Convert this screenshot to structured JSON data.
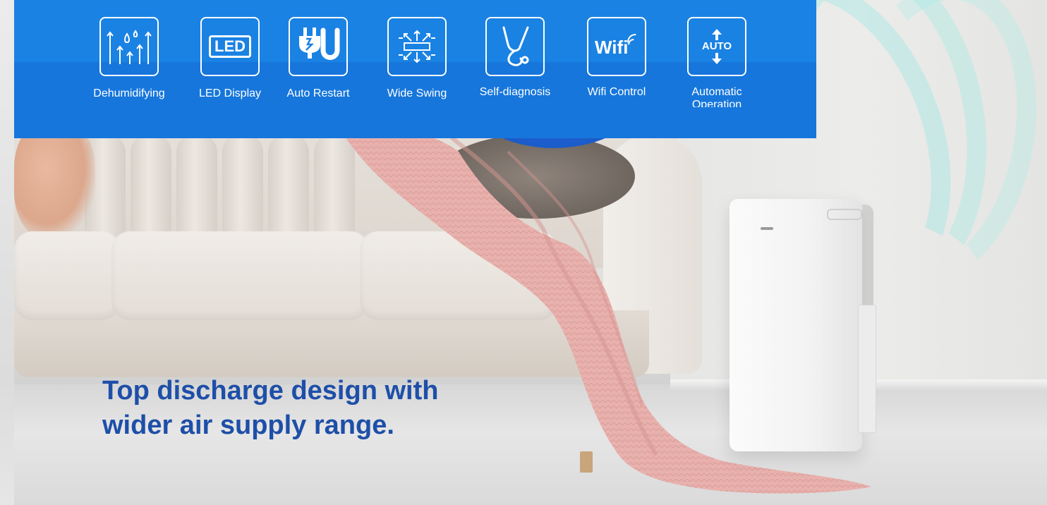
{
  "features": [
    {
      "label": "Dehumidifying",
      "icon": "dehumidify-drops-icon"
    },
    {
      "label": "LED Display",
      "icon": "led-display-icon",
      "icon_text": "LED"
    },
    {
      "label": "Auto Restart",
      "icon": "plug-restart-icon"
    },
    {
      "label": "Wide Swing",
      "icon": "wide-swing-icon"
    },
    {
      "label": "Self-diagnosis",
      "icon": "stethoscope-icon"
    },
    {
      "label": "Wifi Control",
      "icon": "wifi-icon",
      "icon_text": "Wifi"
    },
    {
      "label": "Automatic Operation",
      "icon": "auto-operation-icon",
      "icon_text": "AUTO"
    }
  ],
  "headline": "Top discharge design with wider air supply range.",
  "colors": {
    "banner": "#1a82e3",
    "headline": "#1e4fa8",
    "blanket": "#e9b1ad"
  }
}
